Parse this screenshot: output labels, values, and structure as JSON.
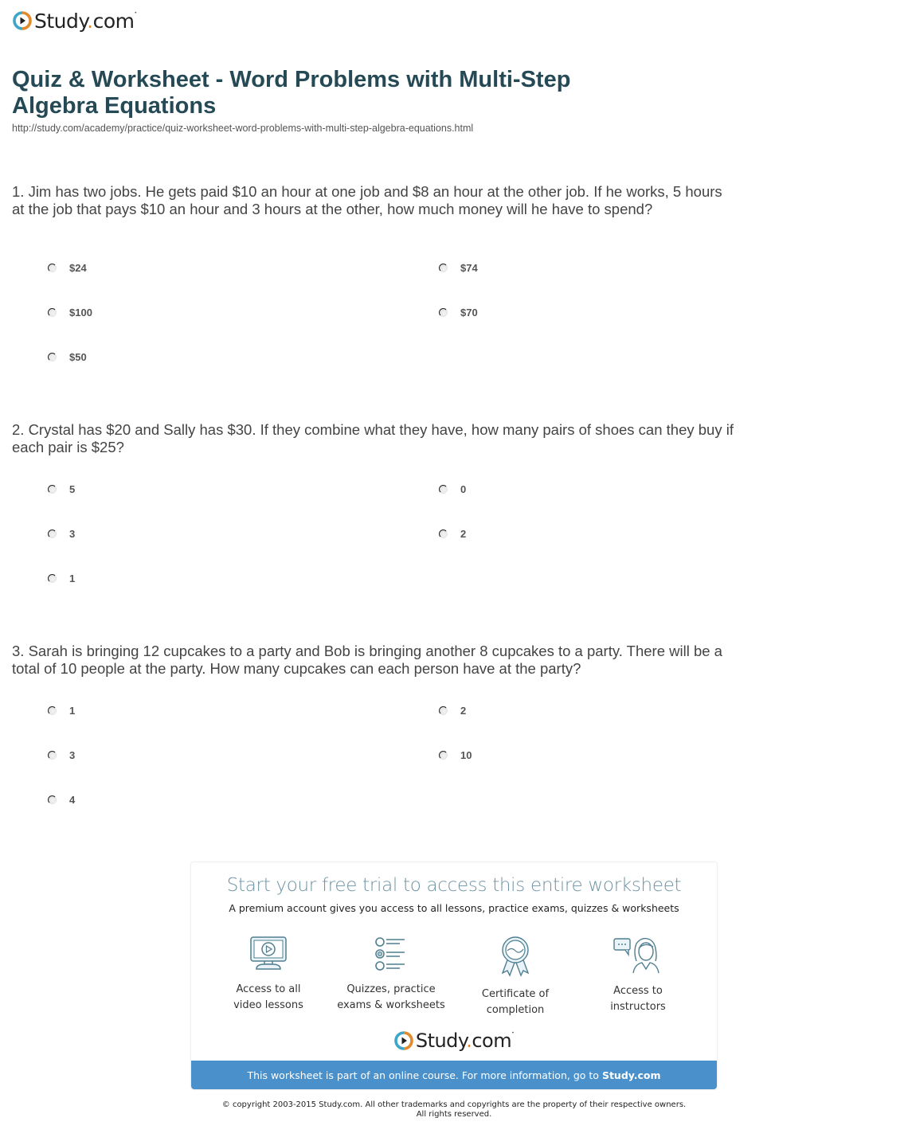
{
  "header": {
    "logo_text_main": "Study",
    "logo_text_dot": ".",
    "logo_text_tail": "com",
    "brand_colors": {
      "ring_left": "#3fa6c7",
      "ring_right": "#e38b2c",
      "play": "#222222"
    }
  },
  "page": {
    "title": "Quiz & Worksheet - Word Problems with Multi-Step Algebra Equations",
    "url": "http://study.com/academy/practice/quiz-worksheet-word-problems-with-multi-step-algebra-equations.html"
  },
  "questions": [
    {
      "text": "1. Jim has two jobs. He gets paid $10 an hour at one job and $8 an hour at the other job. If he works, 5 hours at the job that pays $10 an hour and 3 hours at the other, how much money will he have to spend?",
      "answers": [
        "$24",
        "$74",
        "$100",
        "$70",
        "$50"
      ]
    },
    {
      "text": "2. Crystal has $20 and Sally has $30. If they combine what they have, how many pairs of shoes can they buy if each pair is $25?",
      "answers": [
        "5",
        "0",
        "3",
        "2",
        "1"
      ]
    },
    {
      "text": "3. Sarah is bringing 12 cupcakes to a party and Bob is bringing another 8 cupcakes to a party. There will be a total of 10 people at the party. How many cupcakes can each person have at the party?",
      "answers": [
        "1",
        "2",
        "3",
        "10",
        "4"
      ]
    }
  ],
  "promo": {
    "headline": "Start your free trial to access this entire worksheet",
    "subhead": "A premium account gives you access to all lessons, practice exams, quizzes & worksheets",
    "features": [
      {
        "icon": "video-monitor-icon",
        "line1": "Access to all",
        "line2": "video lessons"
      },
      {
        "icon": "quiz-list-icon",
        "line1": "Quizzes, practice",
        "line2": "exams & worksheets"
      },
      {
        "icon": "certificate-ribbon-icon",
        "line1": "Certificate of",
        "line2": "completion"
      },
      {
        "icon": "instructor-chat-icon",
        "line1": "Access to",
        "line2": "instructors"
      }
    ],
    "banner_text": "This worksheet is part of an online course. For more information, go to",
    "banner_link": "Study.com",
    "accent_color": "#4a90cb",
    "icon_color": "#4f7f90"
  },
  "footer": {
    "line1": "© copyright 2003-2015 Study.com. All other trademarks and copyrights are the property of their respective owners.",
    "line2": "All rights reserved."
  }
}
